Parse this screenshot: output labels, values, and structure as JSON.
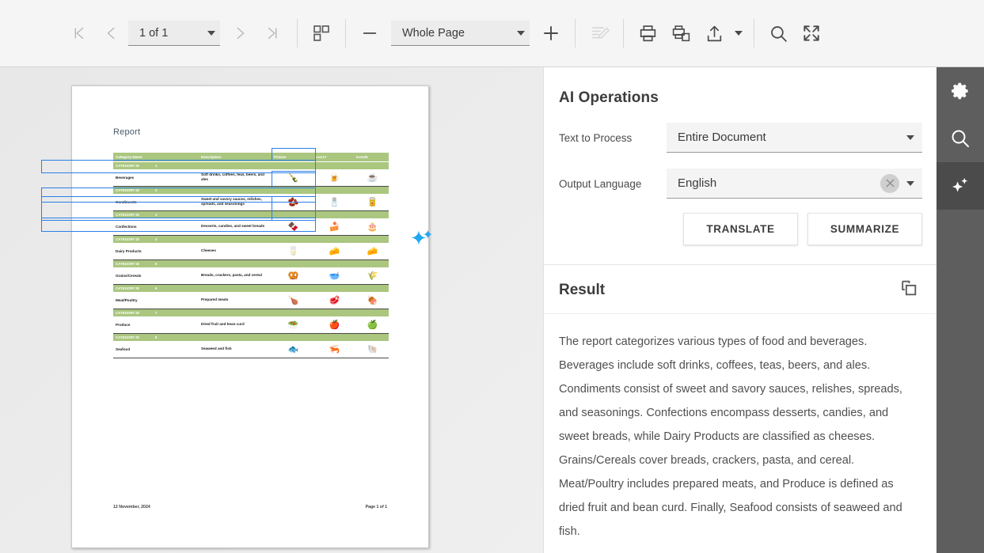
{
  "toolbar": {
    "first_page_icon": "first-page-icon",
    "prev_page_icon": "previous-page-icon",
    "page_indicator": "1 of 1",
    "next_page_icon": "next-page-icon",
    "last_page_icon": "last-page-icon",
    "thumbnails_icon": "thumbnail-grid-icon",
    "zoom_out_icon": "minus-icon",
    "zoom_level": "Whole Page",
    "zoom_in_icon": "plus-icon",
    "annotate_icon": "annotation-edit-icon",
    "print_icon": "print-icon",
    "print_copies_icon": "print-multiple-icon",
    "upload_icon": "upload-icon",
    "upload_caret_icon": "chevron-down-icon",
    "search_icon": "search-icon",
    "fullscreen_icon": "fullscreen-icon"
  },
  "document": {
    "title": "Report",
    "footer_date": "12 November, 2024",
    "footer_page": "Page 1 of 1",
    "sparkle_icon": "ai-sparkle-icon",
    "table": {
      "headers": [
        "Category Name",
        "Description",
        "Picture",
        "Icon17",
        "Icon25"
      ],
      "category_label": "CATEGORY ID",
      "rows": [
        {
          "id": "1",
          "name": "Beverages",
          "description": "Soft drinks, coffees, teas, beers, and ales",
          "picture": "🍾",
          "icon17": "🍺",
          "icon25": "☕"
        },
        {
          "id": "2",
          "name": "Condiments",
          "description": "Sweet and savory sauces, relishes, spreads, and seasonings",
          "picture": "🫘",
          "icon17": "🧂",
          "icon25": "🥫"
        },
        {
          "id": "3",
          "name": "Confections",
          "description": "Desserts, candies, and sweet breads",
          "picture": "🍫",
          "icon17": "🍰",
          "icon25": "🎂"
        },
        {
          "id": "4",
          "name": "Dairy Products",
          "description": "Cheeses",
          "picture": "🥛",
          "icon17": "🧀",
          "icon25": "🧀"
        },
        {
          "id": "5",
          "name": "Grains/Cereals",
          "description": "Breads, crackers, pasta, and cereal",
          "picture": "🥨",
          "icon17": "🥣",
          "icon25": "🌾"
        },
        {
          "id": "6",
          "name": "Meat/Poultry",
          "description": "Prepared meats",
          "picture": "🍗",
          "icon17": "🥩",
          "icon25": "🍖"
        },
        {
          "id": "7",
          "name": "Produce",
          "description": "Dried fruit and bean curd",
          "picture": "🥗",
          "icon17": "🍎",
          "icon25": "🍏"
        },
        {
          "id": "8",
          "name": "Seafood",
          "description": "Seaweed and fish",
          "picture": "🐟",
          "icon17": "🦐",
          "icon25": "🐚"
        }
      ]
    }
  },
  "ai_panel": {
    "title": "AI Operations",
    "text_to_process_label": "Text to Process",
    "text_to_process_value": "Entire Document",
    "output_language_label": "Output Language",
    "output_language_value": "English",
    "clear_icon": "clear-x-icon",
    "dropdown_icon": "chevron-down-icon",
    "translate_label": "TRANSLATE",
    "summarize_label": "SUMMARIZE",
    "result_title": "Result",
    "copy_icon": "copy-icon",
    "result_text": "The report categorizes various types of food and beverages. Beverages include soft drinks, coffees, teas, beers, and ales. Condiments consist of sweet and savory sauces, relishes, spreads, and seasonings. Confections encompass desserts, candies, and sweet breads, while Dairy Products are classified as cheeses. Grains/Cereals cover breads, crackers, pasta, and cereal. Meat/Poultry includes prepared meats, and Produce is defined as dried fruit and bean curd. Finally, Seafood consists of seaweed and fish."
  },
  "rail": {
    "settings_icon": "gear-icon",
    "search_icon": "search-icon",
    "ai_icon": "ai-sparkle-icon"
  },
  "colors": {
    "table_green": "#aac67f",
    "selection_blue": "#2a7fe8",
    "sparkle_blue": "#21a7f0",
    "rail_bg": "#5e5e5e",
    "rail_active": "#4b4b4b"
  }
}
